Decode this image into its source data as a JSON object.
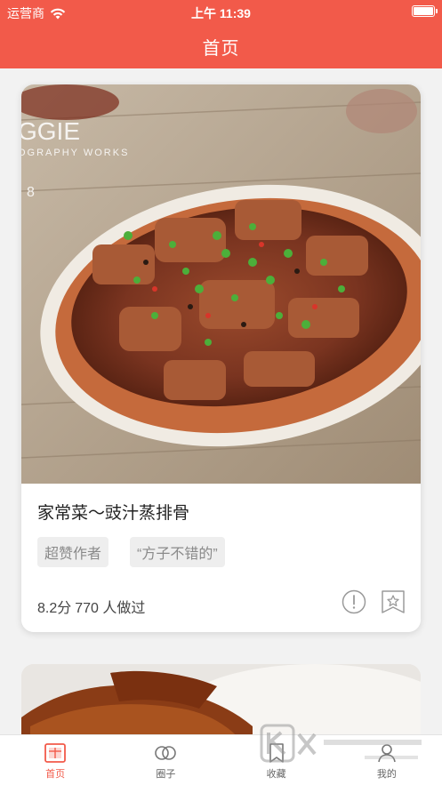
{
  "status_bar": {
    "carrier": "运营商",
    "time": "上午 11:39"
  },
  "header": {
    "title": "首页"
  },
  "colors": {
    "accent": "#f25a4a",
    "tag_bg": "#eeeeee",
    "tag_text": "#8a8a8a"
  },
  "feed": {
    "items": [
      {
        "title": "家常菜～豉汁蒸排骨",
        "tags": [
          "超赞作者",
          "“方子不错的”"
        ],
        "score": "8.2分",
        "made_count": "770 人做过",
        "photo_watermark": [
          "GGIE",
          "OGRAPHY WORKS",
          "8"
        ],
        "action_icons": [
          "exclamation-circle-icon",
          "star-bookmark-icon"
        ]
      }
    ]
  },
  "tabbar": {
    "items": [
      {
        "label": "首页",
        "icon": "home-icon",
        "active": true
      },
      {
        "label": "圈子",
        "icon": "circles-icon",
        "active": false
      },
      {
        "label": "收藏",
        "icon": "bookmark-icon",
        "active": false
      },
      {
        "label": "我的",
        "icon": "profile-icon",
        "active": false
      }
    ]
  }
}
